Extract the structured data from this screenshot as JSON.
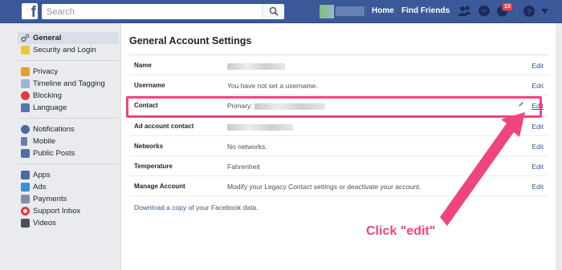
{
  "topbar": {
    "search_placeholder": "Search",
    "nav": {
      "home": "Home",
      "find_friends": "Find Friends"
    },
    "notification_count": "13",
    "brand_color": "#3b5998"
  },
  "sidebar": {
    "groups": [
      [
        {
          "label": "General",
          "icon": "gear-icon",
          "active": true
        },
        {
          "label": "Security and Login",
          "icon": "lock-icon"
        }
      ],
      [
        {
          "label": "Privacy",
          "icon": "privacy-lock-icon"
        },
        {
          "label": "Timeline and Tagging",
          "icon": "timeline-icon"
        },
        {
          "label": "Blocking",
          "icon": "block-icon"
        },
        {
          "label": "Language",
          "icon": "language-icon"
        }
      ],
      [
        {
          "label": "Notifications",
          "icon": "globe-icon"
        },
        {
          "label": "Mobile",
          "icon": "mobile-icon"
        },
        {
          "label": "Public Posts",
          "icon": "rss-icon"
        }
      ],
      [
        {
          "label": "Apps",
          "icon": "apps-icon"
        },
        {
          "label": "Ads",
          "icon": "ads-icon"
        },
        {
          "label": "Payments",
          "icon": "payments-icon"
        },
        {
          "label": "Support Inbox",
          "icon": "support-icon"
        },
        {
          "label": "Videos",
          "icon": "video-icon"
        }
      ]
    ]
  },
  "main": {
    "title": "General Account Settings",
    "edit_label": "Edit",
    "rows": [
      {
        "label": "Name",
        "value": ""
      },
      {
        "label": "Username",
        "value": "You have not set a username."
      },
      {
        "label": "Contact",
        "value": "Primary:"
      },
      {
        "label": "Ad account contact",
        "value": ""
      },
      {
        "label": "Networks",
        "value": "No networks."
      },
      {
        "label": "Temperature",
        "value": "Fahrenheit"
      },
      {
        "label": "Manage Account",
        "value": "Modify your Legacy Contact settings or deactivate your account."
      }
    ],
    "download_link": "Download a copy",
    "download_suffix": " of your Facebook data."
  },
  "annotation": {
    "text": "Click \"edit\"",
    "color": "#f0447f"
  }
}
